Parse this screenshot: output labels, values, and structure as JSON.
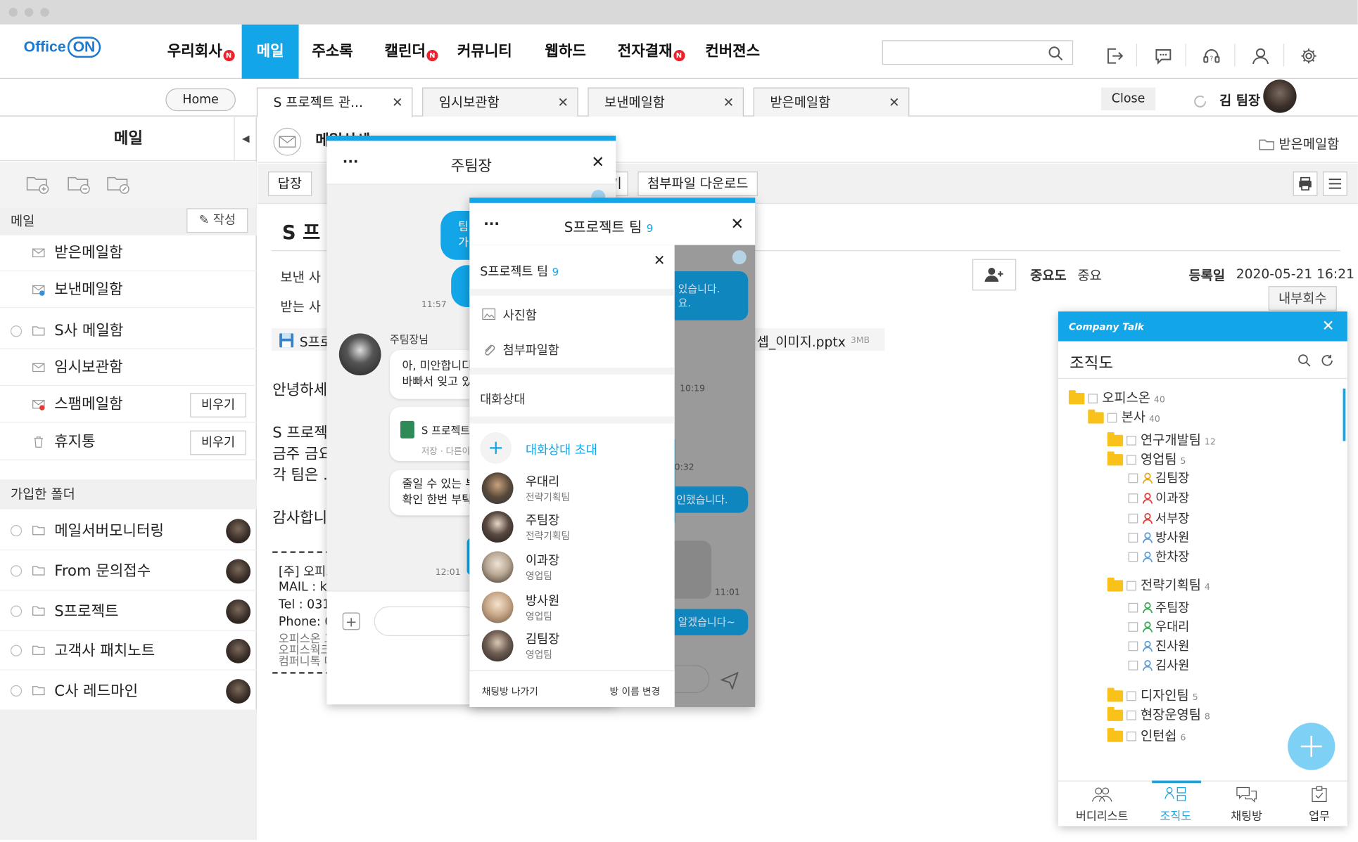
{
  "app": {
    "logo_text": "Office",
    "logo_on": "ON"
  },
  "nav": {
    "items": [
      {
        "label": "우리회사",
        "badge": "N"
      },
      {
        "label": "메일",
        "active": true
      },
      {
        "label": "주소록"
      },
      {
        "label": "캘린더",
        "badge": "N"
      },
      {
        "label": "커뮤니티"
      },
      {
        "label": "웹하드"
      },
      {
        "label": "전자결재",
        "badge": "N"
      },
      {
        "label": "컨버젼스"
      }
    ]
  },
  "tabs": {
    "home": "Home",
    "items": [
      "S 프로젝트 관...",
      "임시보관함",
      "보낸메일함",
      "받은메일함"
    ],
    "close": "Close",
    "user": "김 팀장"
  },
  "sidebar": {
    "title": "메일",
    "section_mail": "메일",
    "write": "작성",
    "boxes": [
      {
        "label": "받은메일함"
      },
      {
        "label": "보낸메일함"
      },
      {
        "label": "S사 메일함"
      },
      {
        "label": "임시보관함"
      },
      {
        "label": "스팸메일함",
        "action": "비우기"
      },
      {
        "label": "휴지통",
        "action": "비우기"
      }
    ],
    "section_joined": "가입한 폴더",
    "folders": [
      "메일서버모니터링",
      "From 문의접수",
      "S프로젝트",
      "고객사 패치노트",
      "C사 레드마인"
    ]
  },
  "mail": {
    "header_title": "메일상세",
    "inbox_link": "받은메일함",
    "toolbar": {
      "reply": "답장",
      "tail": "기",
      "download": "첨부파일 다운로드"
    },
    "subject": "S 프",
    "sender_label": "보낸 사",
    "receiver_label": "받는 사",
    "importance_label": "중요도",
    "importance_value": "중요",
    "date_label": "등록일",
    "date_value": "2020-05-21 16:21",
    "internal_reply": "내부회수",
    "attachment_left": "S프로",
    "attachment_right": "셉_이미지.pptx",
    "attachment_size": "3MB",
    "body_lines": [
      "안녕하세",
      "S 프로젝",
      "금주 금요",
      "각 팀은 .",
      "감사합니"
    ],
    "signature": [
      "[주] 오피스",
      "MAIL : kin",
      "Tel : 031-",
      "Phone: 01",
      "오피스온 그",
      "오피스웍크 클라우드사이트 : http://www.",
      "컴퍼니톡 메신저솔루션     : http://www."
    ]
  },
  "chat1": {
    "title": "주팀장",
    "menu": "···",
    "my_msg_1": [
      "팀",
      "가"
    ],
    "time_1": "11:57",
    "sender": "주팀장님",
    "other_msg_1": [
      "아, 미안합니다",
      "바빠서 잊고 있"
    ],
    "file_name": "S 프로젝트",
    "file_meta": "저장 · 다른이",
    "other_msg_2": [
      "줄일 수 있는 부",
      "확인 한번 부탁"
    ],
    "time_2": "12:01"
  },
  "chat2": {
    "title": "S프로젝트 팀",
    "count": "9",
    "menu": "···",
    "drawer_title": "S프로젝트 팀",
    "drawer_count": "9",
    "photos": "사진함",
    "files": "첨부파일함",
    "members_label": "대화상대",
    "invite": "대화상대 초대",
    "members": [
      {
        "name": "우대리",
        "dept": "전략기획팀"
      },
      {
        "name": "주팀장",
        "dept": "전략기획팀"
      },
      {
        "name": "이과장",
        "dept": "영업팀"
      },
      {
        "name": "방사원",
        "dept": "영업팀"
      },
      {
        "name": "김팀장",
        "dept": "영업팀"
      }
    ],
    "leave": "채팅방 나가기",
    "rename": "방 이름 변경",
    "bg_msg_1": [
      "있습니다.",
      "요."
    ],
    "bg_time_1": "10:19",
    "bg_time_2": "0:32",
    "bg_msg_2": "인했습니다.",
    "bg_time_3": "11:01",
    "bg_msg_3": "알겠습니다~"
  },
  "companytalk": {
    "brand": "Company Talk",
    "title": "조직도",
    "tree": [
      {
        "label": "오피스온",
        "count": "40",
        "type": "folder",
        "level": 0
      },
      {
        "label": "본사",
        "count": "40",
        "type": "folder",
        "level": 1
      },
      {
        "label": "연구개발팀",
        "count": "12",
        "type": "folder",
        "level": 2
      },
      {
        "label": "영업팀",
        "count": "5",
        "type": "folder",
        "level": 2
      },
      {
        "label": "김팀장",
        "type": "person",
        "color": "#e6a817",
        "level": 3
      },
      {
        "label": "이과장",
        "type": "person",
        "color": "#e53935",
        "level": 3
      },
      {
        "label": "서부장",
        "type": "person",
        "color": "#e53935",
        "level": 3
      },
      {
        "label": "방사원",
        "type": "person",
        "color": "#5b9bd5",
        "level": 3
      },
      {
        "label": "한차장",
        "type": "person",
        "color": "#5b9bd5",
        "level": 3
      },
      {
        "label": "전략기획팀",
        "count": "4",
        "type": "folder",
        "level": 2
      },
      {
        "label": "주팀장",
        "type": "person",
        "color": "#3aa757",
        "level": 3
      },
      {
        "label": "우대리",
        "type": "person",
        "color": "#3aa757",
        "level": 3
      },
      {
        "label": "진사원",
        "type": "person",
        "color": "#5b9bd5",
        "level": 3
      },
      {
        "label": "김사원",
        "type": "person",
        "color": "#5b9bd5",
        "level": 3
      },
      {
        "label": "디자인팀",
        "count": "5",
        "type": "folder",
        "level": 2
      },
      {
        "label": "현장운영팀",
        "count": "8",
        "type": "folder",
        "level": 2
      },
      {
        "label": "인턴쉽",
        "count": "6",
        "type": "folder",
        "level": 2
      }
    ],
    "bottom_nav": [
      "버디리스트",
      "조직도",
      "채팅방",
      "업무"
    ],
    "active_tab": "조직도"
  },
  "colors": {
    "accent": "#12a5e8",
    "badge": "#e8252e",
    "folder": "#f8c21a"
  }
}
